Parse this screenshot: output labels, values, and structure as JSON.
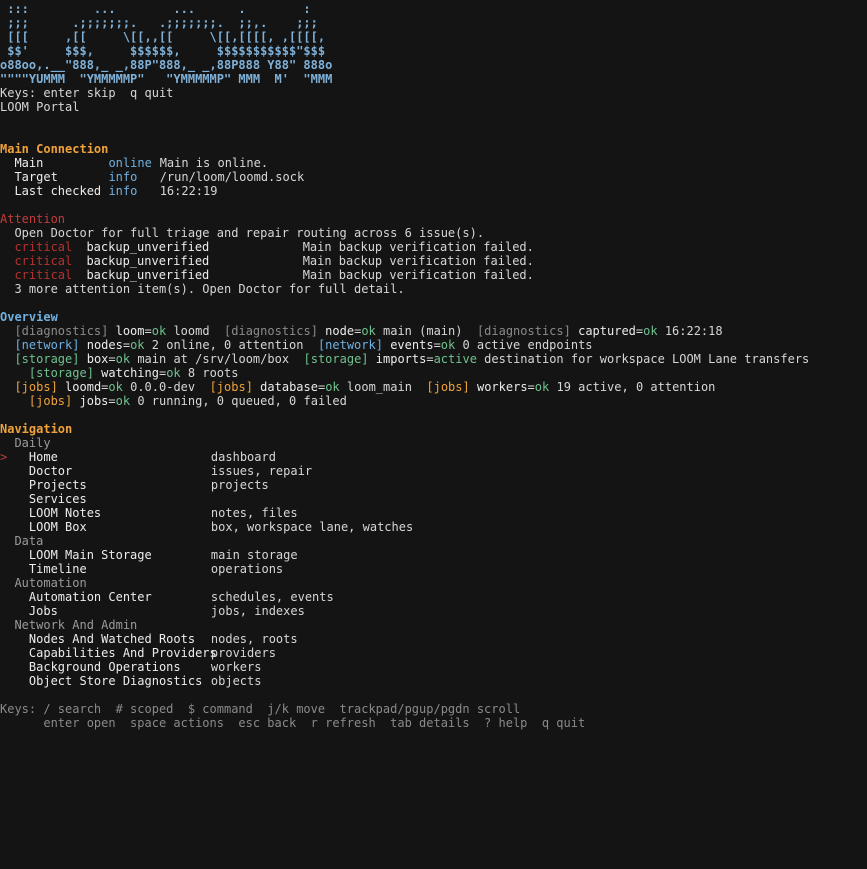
{
  "logo": [
    " :::         ...        ...      .        :",
    " ;;;      .;;;;;;;.   .;;;;;;;.  ;;,.    ;;;",
    " [[[     ,[[     \\[[,,[[     \\[[,[[[[, ,[[[[,",
    " $$'     $$$,     $$$$$$,     $$$$$$$$$$$\"$$$",
    "o88oo,.__\"888,_ _,88P\"888,_ _,88P888 Y88\" 888o",
    "\"\"\"\"YUMMM  \"YMMMMMP\"   \"YMMMMMP\" MMM  M'  \"MMM"
  ],
  "top_keys": "Keys: enter skip  q quit",
  "portal_title": "LOOM Portal",
  "main_connection": {
    "heading": "Main Connection",
    "rows": [
      {
        "key": "Main",
        "status": "online",
        "value": "Main is online."
      },
      {
        "key": "Target",
        "status": "info",
        "value": "/run/loom/loomd.sock"
      },
      {
        "key": "Last checked",
        "status": "info",
        "value": "16:22:19"
      }
    ]
  },
  "attention": {
    "heading": "Attention",
    "intro": "Open Doctor for full triage and repair routing across 6 issue(s).",
    "items": [
      {
        "severity": "critical",
        "code": "backup_unverified",
        "message": "Main backup verification failed."
      },
      {
        "severity": "critical",
        "code": "backup_unverified",
        "message": "Main backup verification failed."
      },
      {
        "severity": "critical",
        "code": "backup_unverified",
        "message": "Main backup verification failed."
      }
    ],
    "more": "3 more attention item(s). Open Doctor for full detail."
  },
  "overview": {
    "heading": "Overview",
    "line1": [
      {
        "tag": "[diagnostics]",
        "key": "loom",
        "state": "ok",
        "detail": "loomd"
      },
      {
        "tag": "[diagnostics]",
        "key": "node",
        "state": "ok",
        "detail": "main (main)"
      },
      {
        "tag": "[diagnostics]",
        "key": "captured",
        "state": "ok",
        "detail": "16:22:18"
      }
    ],
    "line2": [
      {
        "tag": "[network]",
        "key": "nodes",
        "state": "ok",
        "detail": "2 online, 0 attention"
      },
      {
        "tag": "[network]",
        "key": "events",
        "state": "ok",
        "detail": "0 active endpoints"
      }
    ],
    "line3": [
      {
        "tag": "[storage]",
        "key": "box",
        "state": "ok",
        "detail": "main at /srv/loom/box"
      },
      {
        "tag": "[storage]",
        "key": "imports",
        "state": "active",
        "detail": "destination for workspace LOOM Lane transfers"
      }
    ],
    "line4": [
      {
        "tag": "[storage]",
        "key": "watching",
        "state": "ok",
        "detail": "8 roots"
      }
    ],
    "line5": [
      {
        "tag": "[jobs]",
        "key": "loomd",
        "state": "ok",
        "detail": "0.0.0-dev"
      },
      {
        "tag": "[jobs]",
        "key": "database",
        "state": "ok",
        "detail": "loom_main"
      },
      {
        "tag": "[jobs]",
        "key": "workers",
        "state": "ok",
        "detail": "19 active, 0 attention"
      }
    ],
    "line6": [
      {
        "tag": "[jobs]",
        "key": "jobs",
        "state": "ok",
        "detail": "0 running, 0 queued, 0 failed"
      }
    ]
  },
  "navigation": {
    "heading": "Navigation",
    "cursor": ">",
    "groups": [
      {
        "name": "Daily",
        "items": [
          {
            "label": "Home",
            "desc": "dashboard"
          },
          {
            "label": "Doctor",
            "desc": "issues, repair"
          },
          {
            "label": "Projects",
            "desc": "projects"
          },
          {
            "label": "Services",
            "desc": ""
          },
          {
            "label": "LOOM Notes",
            "desc": "notes, files"
          },
          {
            "label": "LOOM Box",
            "desc": "box, workspace lane, watches"
          }
        ]
      },
      {
        "name": "Data",
        "items": [
          {
            "label": "LOOM Main Storage",
            "desc": "main storage"
          },
          {
            "label": "Timeline",
            "desc": "operations"
          }
        ]
      },
      {
        "name": "Automation",
        "items": [
          {
            "label": "Automation Center",
            "desc": "schedules, events"
          },
          {
            "label": "Jobs",
            "desc": "jobs, indexes"
          }
        ]
      },
      {
        "name": "Network And Admin",
        "items": [
          {
            "label": "Nodes And Watched Roots",
            "desc": "nodes, roots"
          },
          {
            "label": "Capabilities And Providers",
            "desc": "providers"
          },
          {
            "label": "Background Operations",
            "desc": "workers"
          },
          {
            "label": "Object Store Diagnostics",
            "desc": "objects"
          }
        ]
      }
    ]
  },
  "footer": {
    "line1": "Keys: / search  # scoped  $ command  j/k move  trackpad/pgup/pgdn scroll",
    "line2": "      enter open  space actions  esc back  r refresh  tab details  ? help  q quit"
  }
}
